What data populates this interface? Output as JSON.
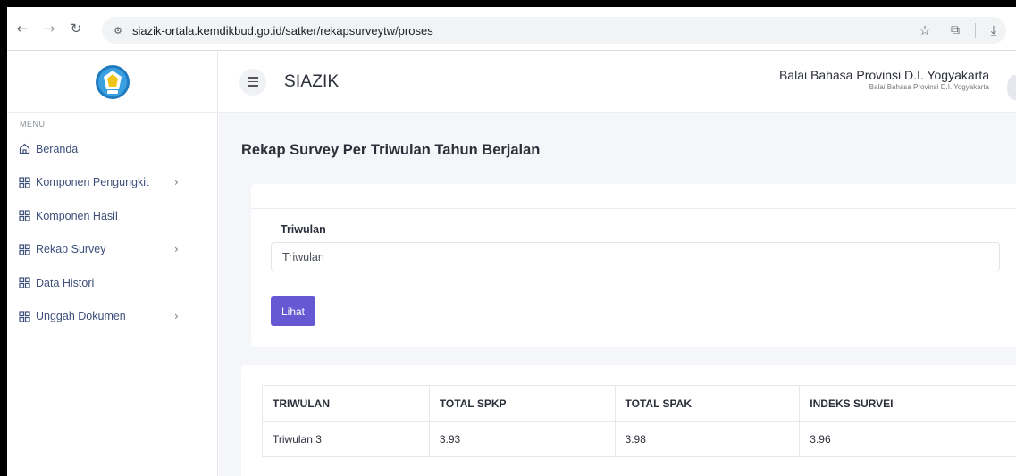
{
  "browser": {
    "url": "siazik-ortala.kemdikbud.go.id/satker/rekapsurveytw/proses",
    "icons": [
      "back-icon",
      "forward-icon",
      "reload-icon",
      "site-settings-icon",
      "star-icon",
      "extensions-icon",
      "download-icon"
    ]
  },
  "sidebar": {
    "menu_title": "MENU",
    "items": [
      {
        "label": "Beranda",
        "icon": "home-icon",
        "has_submenu": false
      },
      {
        "label": "Komponen Pengungkit",
        "icon": "grid-icon",
        "has_submenu": true
      },
      {
        "label": "Komponen Hasil",
        "icon": "grid-icon",
        "has_submenu": false
      },
      {
        "label": "Rekap Survey",
        "icon": "grid-icon",
        "has_submenu": true
      },
      {
        "label": "Data Histori",
        "icon": "grid-icon",
        "has_submenu": false
      },
      {
        "label": "Unggah Dokumen",
        "icon": "grid-icon",
        "has_submenu": true
      }
    ]
  },
  "header": {
    "app_title": "SIAZIK",
    "user_name": "Balai Bahasa Provinsi D.I. Yogyakarta",
    "user_subtitle": "Balai Bahasa Provinsi D.I. Yogyakarta"
  },
  "main": {
    "page_title": "Rekap Survey Per Triwulan Tahun Berjalan",
    "filter": {
      "label": "Triwulan",
      "value": "Triwulan",
      "button_label": "Lihat"
    },
    "table": {
      "headers": [
        "TRIWULAN",
        "TOTAL SPKP",
        "TOTAL SPAK",
        "INDEKS SURVEI"
      ],
      "rows": [
        [
          "Triwulan 3",
          "3.93",
          "3.98",
          "3.96"
        ]
      ]
    }
  },
  "colors": {
    "primary_button": "#6658d3",
    "sidebar_text": "#3d4f7a",
    "page_background": "#f5f6fa"
  }
}
